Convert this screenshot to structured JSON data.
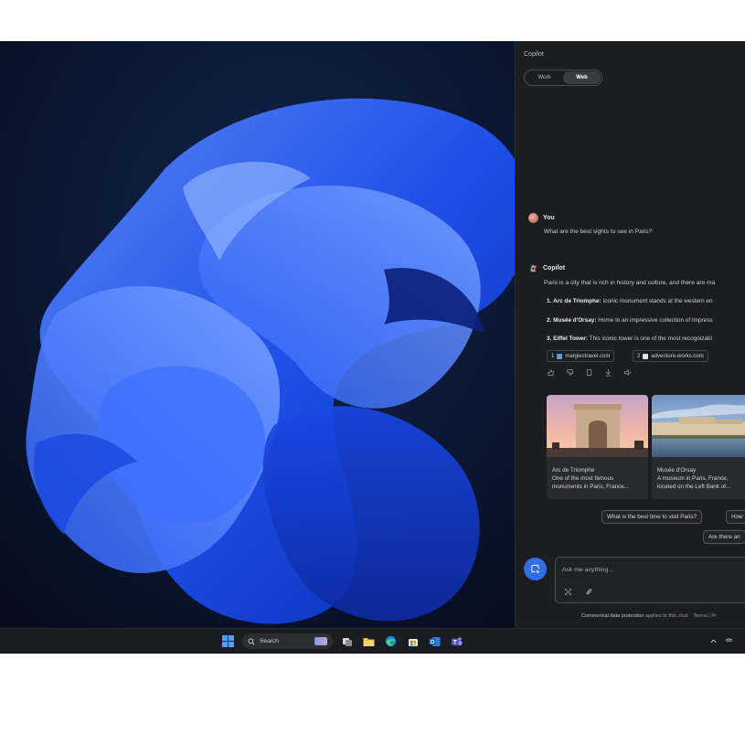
{
  "copilot": {
    "title": "Copilot",
    "toggle": {
      "work": "Work",
      "web": "Web",
      "active": "web"
    },
    "user": {
      "name": "You",
      "message": "What are the best sights to see in Paris?"
    },
    "assistant": {
      "name": "Copilot",
      "intro": "Paris is a city that is rich in history and culture, and there are ma",
      "items": [
        {
          "num": "1.",
          "title": "Arc de Triomphe:",
          "text": "Iconic monument stands at the western en"
        },
        {
          "num": "2.",
          "title": "Musée d'Orsay:",
          "text": "Home to an impressive collection of Impress"
        },
        {
          "num": "3.",
          "title": "Eiffel Tower:",
          "text": "This iconic tower is one of the most recognizabl"
        }
      ],
      "citations": [
        {
          "num": "1",
          "site": "margiestravel.com"
        },
        {
          "num": "2",
          "site": "adventure-works.com"
        }
      ],
      "cards": [
        {
          "title": "Arc de Triomphe",
          "line1": "One of the most famous",
          "line2": "monuments in Paris, France..."
        },
        {
          "title": "Musée d'Orsay",
          "line1": "A museum in Paris, France,",
          "line2": "located on the Left Bank of..."
        }
      ],
      "suggestions": [
        "What is the best time to visit Paris?",
        "How",
        "Are there an"
      ]
    },
    "input": {
      "placeholder": "Ask me anything..."
    },
    "footer": {
      "strong": "Commercial data protection",
      "rest": "applies to this chat",
      "terms": "Terms | Pr"
    }
  },
  "taskbar": {
    "search_label": "Search"
  },
  "colors": {
    "accent": "#2f6fe4",
    "panel": "#1c1d20",
    "taskbar": "#1b1c22"
  }
}
